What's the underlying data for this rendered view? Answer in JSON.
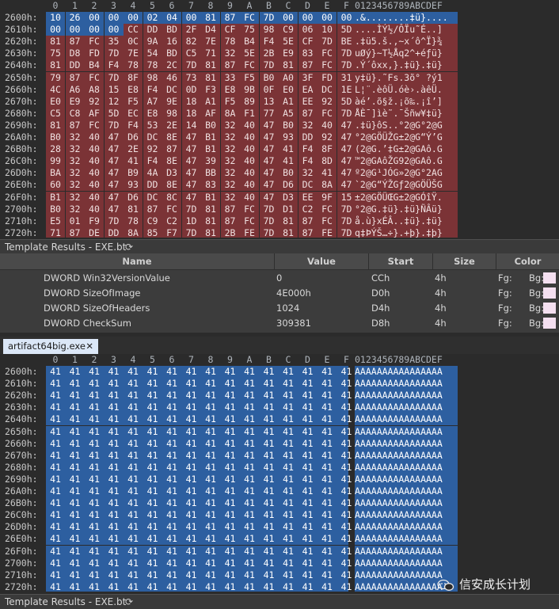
{
  "columns": [
    "0",
    "1",
    "2",
    "3",
    "4",
    "5",
    "6",
    "7",
    "8",
    "9",
    "A",
    "B",
    "C",
    "D",
    "E",
    "F"
  ],
  "ascii_header": "0123456789ABCDEF",
  "top_pane": {
    "rows": [
      {
        "addr": "2600h:",
        "bytes": [
          "10",
          "26",
          "00",
          "00",
          "00",
          "02",
          "04",
          "00",
          "81",
          "87",
          "FC",
          "7D",
          "00",
          "00",
          "00",
          "00"
        ],
        "ascii": ".&........‡ü}...."
      },
      {
        "addr": "2610h:",
        "bytes": [
          "00",
          "00",
          "00",
          "00",
          "CC",
          "DD",
          "BD",
          "2F",
          "D4",
          "CF",
          "75",
          "98",
          "C9",
          "06",
          "10",
          "5D"
        ],
        "ascii": "....ÌÝ½/ÔÏu˜É..]"
      },
      {
        "addr": "2620h:",
        "bytes": [
          "81",
          "87",
          "FC",
          "35",
          "0C",
          "9A",
          "16",
          "82",
          "7E",
          "78",
          "B4",
          "F4",
          "5E",
          "CF",
          "7D",
          "BE"
        ],
        "ascii": ".‡ü5.š.‚~x´ô^Ï}¾"
      },
      {
        "addr": "2630h:",
        "bytes": [
          "75",
          "D8",
          "FD",
          "7D",
          "7E",
          "54",
          "BD",
          "C5",
          "71",
          "32",
          "5E",
          "2B",
          "E9",
          "83",
          "FC",
          "7D"
        ],
        "ascii": "uØý}~T½Åq2^+éƒü}"
      },
      {
        "addr": "2640h:",
        "bytes": [
          "81",
          "DD",
          "B4",
          "F4",
          "78",
          "78",
          "2C",
          "7D",
          "81",
          "87",
          "FC",
          "7D",
          "81",
          "87",
          "FC",
          "7D"
        ],
        "ascii": ".Ý´ôxx,}.‡ü}.‡ü}"
      },
      {
        "addr": "2650h:",
        "bytes": [
          "79",
          "87",
          "FC",
          "7D",
          "8F",
          "98",
          "46",
          "73",
          "81",
          "33",
          "F5",
          "B0",
          "A0",
          "3F",
          "FD",
          "31"
        ],
        "ascii": "y‡ü}.˜Fs.3õ° ?ý1"
      },
      {
        "addr": "2660h:",
        "bytes": [
          "4C",
          "A6",
          "A8",
          "15",
          "E8",
          "F4",
          "DC",
          "0D",
          "F3",
          "E8",
          "9B",
          "0F",
          "E0",
          "EA",
          "DC",
          "1E"
        ],
        "ascii": "L¦¨.èôÜ.óè›.àêÜ."
      },
      {
        "addr": "2670h:",
        "bytes": [
          "E0",
          "E9",
          "92",
          "12",
          "F5",
          "A7",
          "9E",
          "18",
          "A1",
          "F5",
          "89",
          "13",
          "A1",
          "EE",
          "92",
          "5D"
        ],
        "ascii": "àé’.õ§ž.¡õ‰.¡î’]"
      },
      {
        "addr": "2680h:",
        "bytes": [
          "C5",
          "C8",
          "AF",
          "5D",
          "EC",
          "E8",
          "98",
          "18",
          "AF",
          "8A",
          "F1",
          "77",
          "A5",
          "87",
          "FC",
          "7D"
        ],
        "ascii": "ÅÈ¯]ìè˜.¯Šñw¥‡ü}"
      },
      {
        "addr": "2690h:",
        "bytes": [
          "81",
          "87",
          "FC",
          "7D",
          "F4",
          "53",
          "2E",
          "14",
          "B0",
          "32",
          "40",
          "47",
          "B0",
          "32",
          "40",
          "47"
        ],
        "ascii": ".‡ü}ôS..°2@G°2@G"
      },
      {
        "addr": "26A0h:",
        "bytes": [
          "B0",
          "32",
          "40",
          "47",
          "D6",
          "DC",
          "8E",
          "47",
          "B1",
          "32",
          "40",
          "47",
          "93",
          "DD",
          "92",
          "47"
        ],
        "ascii": "°2@GÖÜŽG±2@G“Ý’G"
      },
      {
        "addr": "26B0h:",
        "bytes": [
          "28",
          "32",
          "40",
          "47",
          "2E",
          "92",
          "87",
          "47",
          "B1",
          "32",
          "40",
          "47",
          "41",
          "F4",
          "8F",
          "47"
        ],
        "ascii": "(2@G.’‡G±2@GAô.G"
      },
      {
        "addr": "26C0h:",
        "bytes": [
          "99",
          "32",
          "40",
          "47",
          "41",
          "F4",
          "8E",
          "47",
          "39",
          "32",
          "40",
          "47",
          "41",
          "F4",
          "8D",
          "47"
        ],
        "ascii": "™2@GAôŽG92@GAô.G"
      },
      {
        "addr": "26D0h:",
        "bytes": [
          "BA",
          "32",
          "40",
          "47",
          "B9",
          "4A",
          "D3",
          "47",
          "BB",
          "32",
          "40",
          "47",
          "B0",
          "32",
          "41",
          "47"
        ],
        "ascii": "º2@G¹JÓG»2@G°2AG"
      },
      {
        "addr": "26E0h:",
        "bytes": [
          "60",
          "32",
          "40",
          "47",
          "93",
          "DD",
          "8E",
          "47",
          "83",
          "32",
          "40",
          "47",
          "D6",
          "DC",
          "8A",
          "47"
        ],
        "ascii": "`2@G“ÝŽGƒ2@GÖÜŠG"
      },
      {
        "addr": "26F0h:",
        "bytes": [
          "B1",
          "32",
          "40",
          "47",
          "D6",
          "DC",
          "8C",
          "47",
          "B1",
          "32",
          "40",
          "47",
          "D3",
          "EE",
          "9F",
          "15"
        ],
        "ascii": "±2@GÖÜŒG±2@GÓîŸ."
      },
      {
        "addr": "2700h:",
        "bytes": [
          "B0",
          "32",
          "40",
          "47",
          "81",
          "87",
          "FC",
          "7D",
          "81",
          "87",
          "FC",
          "7D",
          "D1",
          "C2",
          "FC",
          "7D"
        ],
        "ascii": "°2@G.‡ü}.‡ü}ÑÂü}"
      },
      {
        "addr": "2710h:",
        "bytes": [
          "E5",
          "01",
          "F9",
          "7D",
          "78",
          "C9",
          "C2",
          "1D",
          "81",
          "87",
          "FC",
          "7D",
          "81",
          "87",
          "FC",
          "7D"
        ],
        "ascii": "å.ù}xÉÂ..‡ü}.‡ü}"
      },
      {
        "addr": "2720h:",
        "bytes": [
          "71",
          "87",
          "DE",
          "DD",
          "8A",
          "85",
          "F7",
          "7D",
          "81",
          "2B",
          "FE",
          "7D",
          "81",
          "87",
          "FE",
          "7D"
        ],
        "ascii": "q‡ÞÝŠ…÷}.+þ}.‡þ}"
      }
    ]
  },
  "template_results_top": {
    "title": "Template Results - EXE.bt",
    "refresh_icon": "refresh-icon",
    "headers": {
      "name": "Name",
      "value": "Value",
      "start": "Start",
      "size": "Size",
      "color": "Color"
    },
    "rows": [
      {
        "name": "DWORD Win32VersionValue",
        "value": "0",
        "start": "CCh",
        "size": "4h",
        "fg": "Fg:",
        "bg": "Bg:"
      },
      {
        "name": "DWORD SizeOfImage",
        "value": "4E000h",
        "start": "D0h",
        "size": "4h",
        "fg": "Fg:",
        "bg": "Bg:"
      },
      {
        "name": "DWORD SizeOfHeaders",
        "value": "1024",
        "start": "D4h",
        "size": "4h",
        "fg": "Fg:",
        "bg": "Bg:"
      },
      {
        "name": "DWORD CheckSum",
        "value": "309381",
        "start": "D8h",
        "size": "4h",
        "fg": "Fg:",
        "bg": "Bg:"
      }
    ]
  },
  "tab": {
    "label": "artifact64big.exe",
    "close": "✕"
  },
  "bottom_pane": {
    "addrs": [
      "2600h:",
      "2610h:",
      "2620h:",
      "2630h:",
      "2640h:",
      "2650h:",
      "2660h:",
      "2670h:",
      "2680h:",
      "2690h:",
      "26A0h:",
      "26B0h:",
      "26C0h:",
      "26D0h:",
      "26E0h:",
      "26F0h:",
      "2700h:",
      "2710h:",
      "2720h:"
    ],
    "byte": "41",
    "ascii": "AAAAAAAAAAAAAAAA"
  },
  "template_results_bottom": {
    "title": "Template Results - EXE.bt"
  },
  "watermark": {
    "text": "信安成长计划"
  },
  "colors": {
    "red_selection": "#7b3336",
    "blue_selection": "#2d5fa0",
    "background": "#2b2b2b",
    "color_swatch": "#f4dff0"
  }
}
